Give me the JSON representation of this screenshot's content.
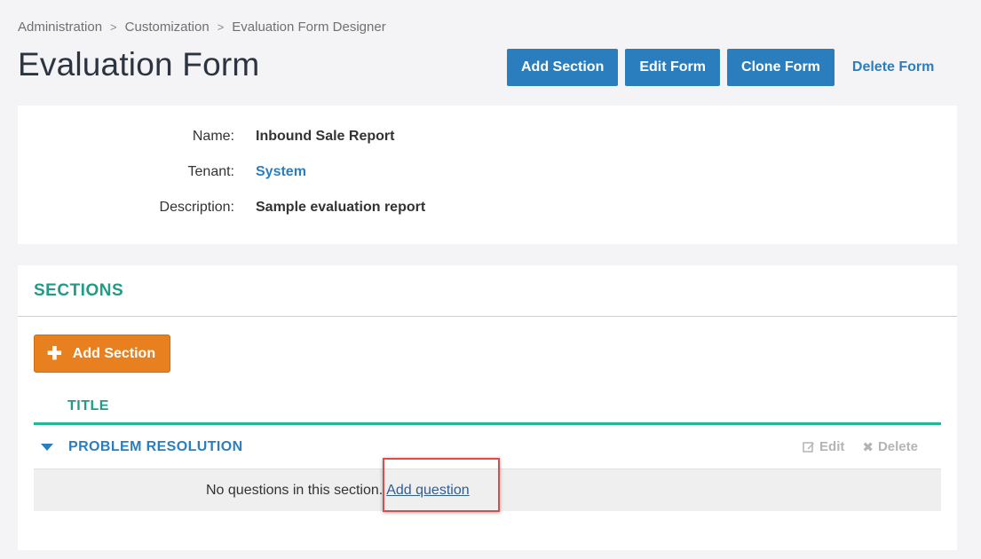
{
  "breadcrumb": [
    "Administration",
    "Customization",
    "Evaluation Form Designer"
  ],
  "page_title": "Evaluation Form",
  "actions": {
    "add_section": "Add Section",
    "edit_form": "Edit Form",
    "clone_form": "Clone Form",
    "delete_form": "Delete Form"
  },
  "form_info": {
    "name_label": "Name:",
    "name_value": "Inbound Sale Report",
    "tenant_label": "Tenant:",
    "tenant_value": "System",
    "description_label": "Description:",
    "description_value": "Sample evaluation report"
  },
  "sections": {
    "heading": "SECTIONS",
    "add_button": "Add Section",
    "column_title": "TITLE",
    "rows": [
      {
        "title": "PROBLEM RESOLUTION",
        "edit_label": "Edit",
        "delete_label": "Delete",
        "empty_text": "No questions in this section.",
        "add_question_link": "Add question"
      }
    ]
  },
  "colors": {
    "primary_blue": "#2a7ebe",
    "accent_teal": "#1e9c86",
    "orange": "#e8801f",
    "highlight_red": "#e04a4a"
  }
}
